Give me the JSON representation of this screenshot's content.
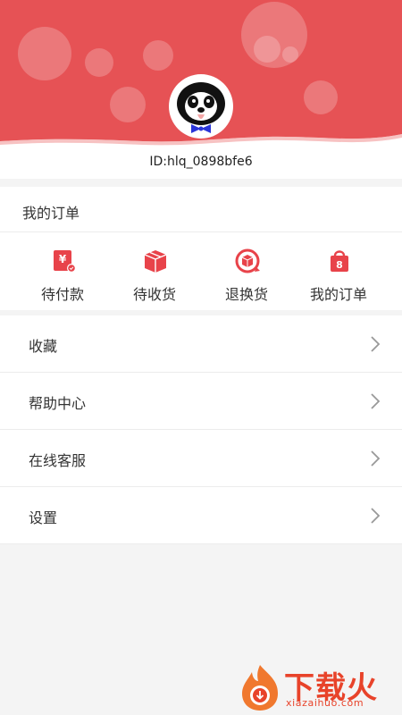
{
  "profile": {
    "user_id": "ID:hlq_0898bfe6",
    "header_color": "#e65255"
  },
  "orders": {
    "title": "我的订单",
    "items": [
      {
        "label": "待付款",
        "icon": "payment-pending-icon"
      },
      {
        "label": "待收货",
        "icon": "box-icon"
      },
      {
        "label": "退换货",
        "icon": "return-icon"
      },
      {
        "label": "我的订单",
        "icon": "bag-icon"
      }
    ],
    "icon_color": "#e8434a"
  },
  "menu": {
    "items": [
      {
        "label": "收藏",
        "icon": "chevron-right-icon"
      },
      {
        "label": "帮助中心",
        "icon": "chevron-right-icon"
      },
      {
        "label": "在线客服",
        "icon": "chevron-right-icon"
      },
      {
        "label": "设置",
        "icon": "chevron-right-icon"
      }
    ]
  },
  "watermark": {
    "title": "下载火",
    "site": "xiazaihuo.com"
  }
}
